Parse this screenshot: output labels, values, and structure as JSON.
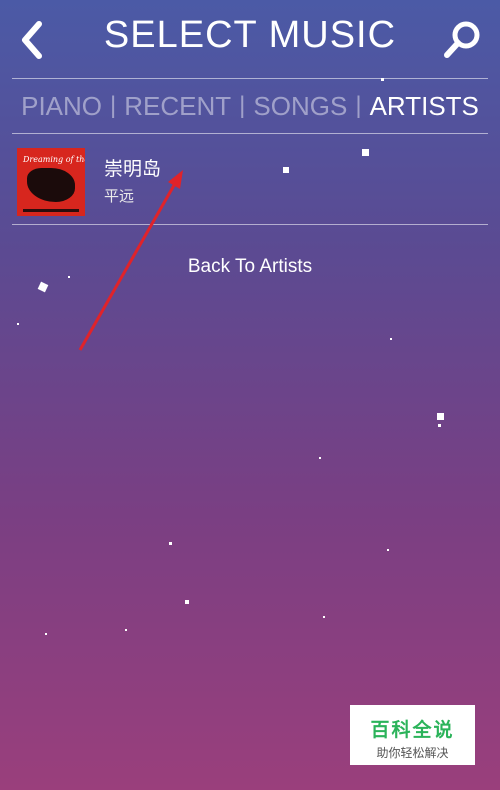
{
  "header": {
    "title": "SELECT MUSIC"
  },
  "tabs": [
    {
      "label": "PIANO",
      "active": false
    },
    {
      "label": "RECENT",
      "active": false
    },
    {
      "label": "SONGS",
      "active": false
    },
    {
      "label": "ARTISTS",
      "active": true
    }
  ],
  "tab_separator": "|",
  "list": [
    {
      "title": "崇明岛",
      "artist": "平远",
      "cover_text": "Dreaming of the East"
    }
  ],
  "back_link": "Back To Artists",
  "watermark": {
    "main": "百科全说",
    "sub": "助你轻松解决"
  },
  "colors": {
    "annotation_arrow": "#e0232a",
    "watermark_green": "#2bb35a"
  },
  "icons": [
    "back-chevron-icon",
    "search-icon"
  ]
}
